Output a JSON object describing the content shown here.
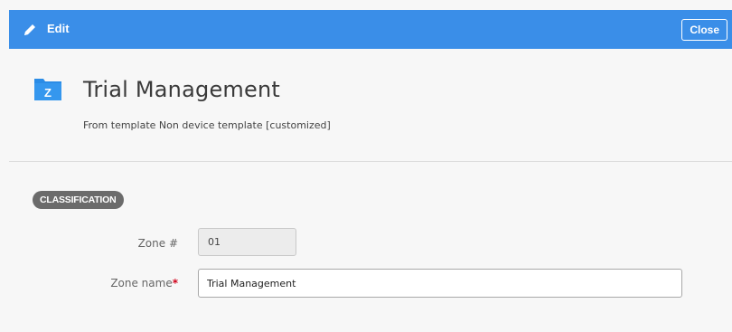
{
  "toolbar": {
    "title": "Edit",
    "icon": "pencil-icon",
    "close_label": "Close",
    "color": "#3a8ee8"
  },
  "header": {
    "icon_letter": "Z",
    "icon": "folder-icon",
    "icon_color": "#2b8ce6",
    "title": "Trial Management",
    "subtitle": "From template Non device template [customized]"
  },
  "section": {
    "label": "CLASSIFICATION"
  },
  "form": {
    "zone_number": {
      "label": "Zone #",
      "value": "01",
      "readonly": true
    },
    "zone_name": {
      "label": "Zone name",
      "required_marker": "*",
      "value": "Trial Management"
    }
  }
}
